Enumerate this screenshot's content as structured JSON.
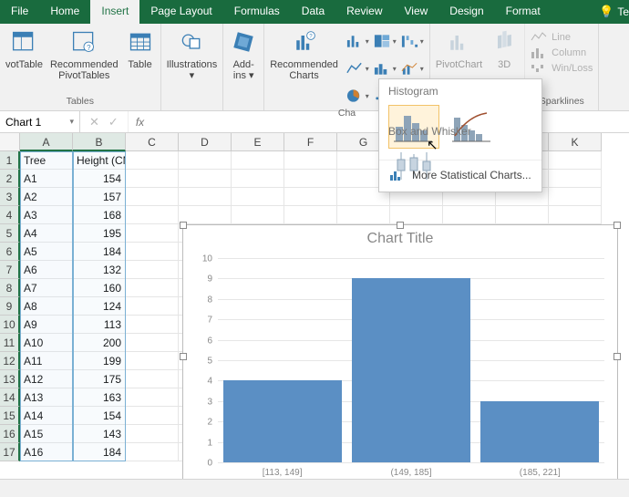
{
  "tabs": [
    "File",
    "Home",
    "Insert",
    "Page Layout",
    "Formulas",
    "Data",
    "Review",
    "View",
    "Design",
    "Format"
  ],
  "active_tab": "Insert",
  "tell_me": "Te",
  "ribbon": {
    "tables": {
      "pivot": "votTable",
      "recpivot_line1": "Recommended",
      "recpivot_line2": "PivotTables",
      "table": "Table",
      "label": "Tables"
    },
    "illus": {
      "btn": "Illustrations",
      "suffix": "▾"
    },
    "addins": {
      "btn_line1": "Add-",
      "btn_line2": "ins ▾"
    },
    "charts": {
      "rec_line1": "Recommended",
      "rec_line2": "Charts",
      "label": "Cha",
      "pivotchart": "PivotChart",
      "threeD": "3D"
    },
    "spark": {
      "line": "Line",
      "column": "Column",
      "winloss": "Win/Loss",
      "label": "Sparklines"
    }
  },
  "popup": {
    "section1": "Histogram",
    "section2": "Box and Whisker",
    "more": "More Statistical Charts..."
  },
  "namebox": "Chart 1",
  "fx_label": "fx",
  "columns": [
    "A",
    "B",
    "C",
    "D",
    "E",
    "F",
    "G",
    "H",
    "I",
    "J",
    "K"
  ],
  "selected_cols": [
    "A",
    "B"
  ],
  "headers": {
    "A": "Tree",
    "B": "Height (CM)"
  },
  "rows": [
    {
      "n": 1
    },
    {
      "n": 2,
      "A": "A1",
      "B": 154
    },
    {
      "n": 3,
      "A": "A2",
      "B": 157
    },
    {
      "n": 4,
      "A": "A3",
      "B": 168
    },
    {
      "n": 5,
      "A": "A4",
      "B": 195
    },
    {
      "n": 6,
      "A": "A5",
      "B": 184
    },
    {
      "n": 7,
      "A": "A6",
      "B": 132
    },
    {
      "n": 8,
      "A": "A7",
      "B": 160
    },
    {
      "n": 9,
      "A": "A8",
      "B": 124
    },
    {
      "n": 10,
      "A": "A9",
      "B": 113
    },
    {
      "n": 11,
      "A": "A10",
      "B": 200
    },
    {
      "n": 12,
      "A": "A11",
      "B": 199
    },
    {
      "n": 13,
      "A": "A12",
      "B": 175
    },
    {
      "n": 14,
      "A": "A13",
      "B": 163
    },
    {
      "n": 15,
      "A": "A14",
      "B": 154
    },
    {
      "n": 16,
      "A": "A15",
      "B": 143
    },
    {
      "n": 17,
      "A": "A16",
      "B": 184
    }
  ],
  "chart_data": {
    "type": "bar",
    "title": "Chart Title",
    "categories": [
      "[113, 149]",
      "(149, 185]",
      "(185, 221]"
    ],
    "values": [
      4,
      9,
      3
    ],
    "ylim": [
      0,
      10
    ],
    "yticks": [
      0,
      1,
      2,
      3,
      4,
      5,
      6,
      7,
      8,
      9,
      10
    ],
    "xlabel": "",
    "ylabel": ""
  }
}
